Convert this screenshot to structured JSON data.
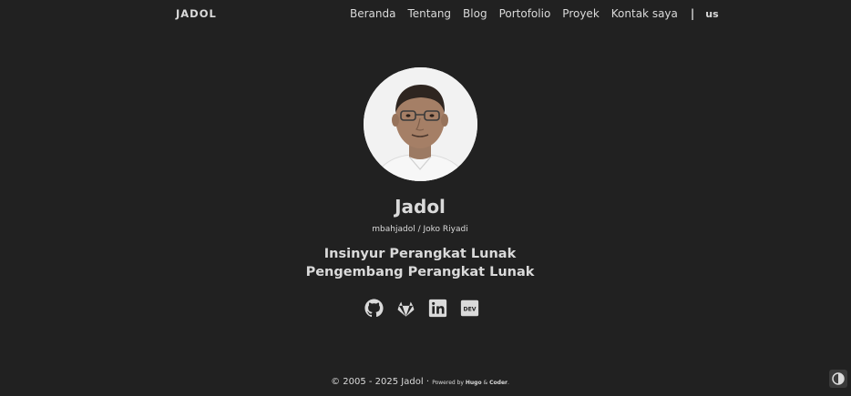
{
  "brand": "JADOL",
  "nav": {
    "items": [
      "Beranda",
      "Tentang",
      "Blog",
      "Portofolio",
      "Proyek",
      "Kontak saya"
    ],
    "separator": "|",
    "lang": "us"
  },
  "profile": {
    "name": "Jadol",
    "handle": "mbahjadol / Joko Riyadi",
    "role_1": "Insinyur Perangkat Lunak",
    "role_2": "Pengembang Perangkat Lunak"
  },
  "social": [
    {
      "name": "github-icon"
    },
    {
      "name": "gitlab-icon"
    },
    {
      "name": "linkedin-icon"
    },
    {
      "name": "dev-icon",
      "text": "DEV"
    }
  ],
  "footer": {
    "copyright": "© 2005 - 2025 Jadol",
    "dot": "·",
    "powered_by": "Powered by",
    "hugo": "Hugo",
    "amp": "&",
    "coder": "Coder",
    "period": "."
  },
  "colors": {
    "background": "#212121",
    "text": "#dadada",
    "avatar_bg": "#f4f4f4"
  }
}
